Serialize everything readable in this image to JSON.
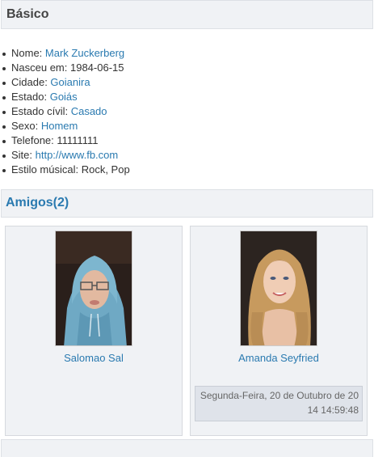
{
  "basic": {
    "title": "Básico",
    "fields": [
      {
        "label": "Nome: ",
        "value": "Mark Zuckerberg",
        "link": true
      },
      {
        "label": "Nasceu em: ",
        "value": "1984-06-15",
        "link": false
      },
      {
        "label": "Cidade: ",
        "value": "Goianira",
        "link": true
      },
      {
        "label": "Estado: ",
        "value": "Goiás",
        "link": true
      },
      {
        "label": "Estado cívil: ",
        "value": "Casado",
        "link": true
      },
      {
        "label": "Sexo: ",
        "value": "Homem",
        "link": true
      },
      {
        "label": "Telefone: ",
        "value": "11111111",
        "link": false
      },
      {
        "label": "Site: ",
        "value": "http://www.fb.com",
        "link": true
      },
      {
        "label": "Estilo músical: ",
        "value": "Rock, Pop",
        "link": false
      }
    ]
  },
  "friends": {
    "title": "Amigos(2)",
    "items": [
      {
        "name": "Salomao Sal"
      },
      {
        "name": "Amanda Seyfried",
        "timestamp": "Segunda-Feira, 20 de Outubro de 2014 14:59:48"
      }
    ]
  }
}
